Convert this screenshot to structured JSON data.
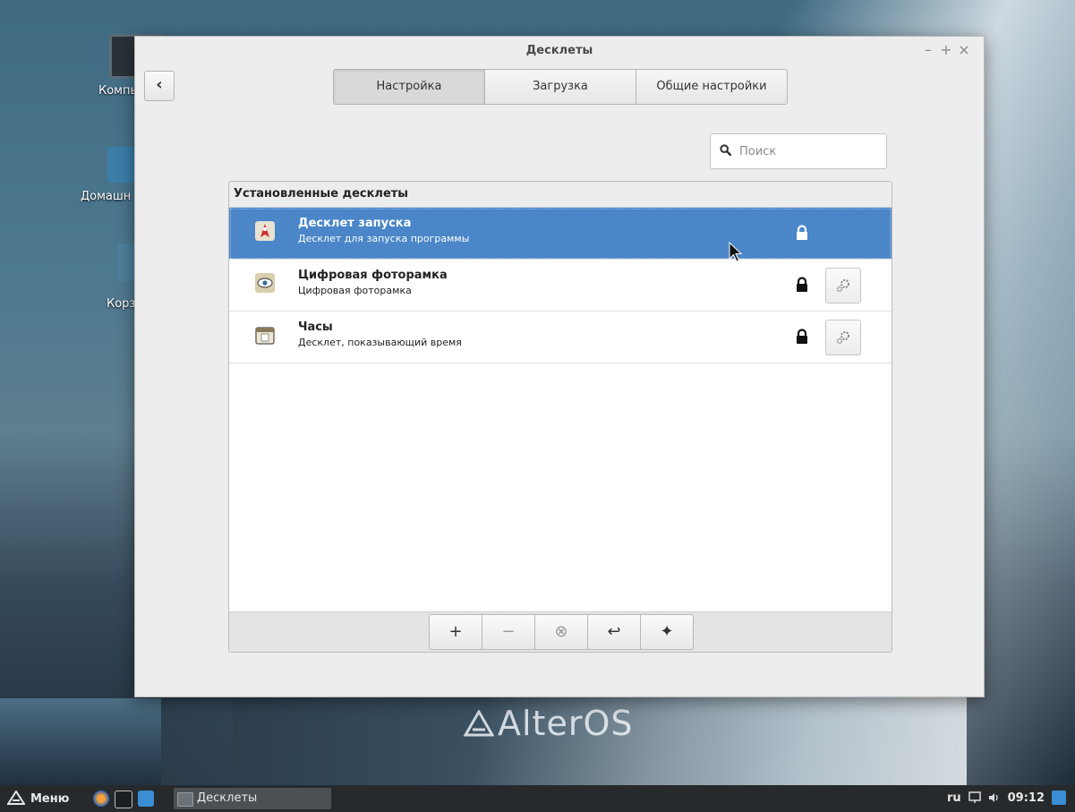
{
  "desktop": {
    "icons": [
      {
        "label": "Компь"
      },
      {
        "label": "Домашн"
      },
      {
        "label": "Корз"
      }
    ],
    "brand": "AlterOS"
  },
  "window": {
    "title": "Десклеты",
    "controls": {
      "minimize": "–",
      "maximize": "+",
      "close": "×"
    },
    "back_label": "‹",
    "tabs": [
      {
        "label": "Настройка",
        "active": true
      },
      {
        "label": "Загрузка",
        "active": false
      },
      {
        "label": "Общие настройки",
        "active": false
      }
    ],
    "search": {
      "placeholder": "Поиск",
      "value": ""
    },
    "list": {
      "header": "Установленные десклеты",
      "items": [
        {
          "name": "Десклет запуска",
          "description": "Десклет для запуска программы",
          "selected": true,
          "locked": true,
          "configurable": false,
          "icon": "launcher-icon"
        },
        {
          "name": "Цифровая фоторамка",
          "description": "Цифровая фоторамка",
          "selected": false,
          "locked": true,
          "configurable": true,
          "icon": "photo-frame-icon"
        },
        {
          "name": "Часы",
          "description": "Десклет, показывающий время",
          "selected": false,
          "locked": true,
          "configurable": true,
          "icon": "calendar-icon"
        }
      ]
    },
    "toolbar": {
      "add": "+",
      "remove": "−",
      "clear": "⊗",
      "restore": "↩",
      "more": "✦"
    }
  },
  "taskbar": {
    "menu_label": "Меню",
    "task_label": "Десклеты",
    "tray": {
      "layout": "ru",
      "clock": "09:12"
    }
  },
  "colors": {
    "selection": "#4a86c8",
    "window_bg": "#ededed",
    "taskbar_bg": "#262a2d"
  }
}
